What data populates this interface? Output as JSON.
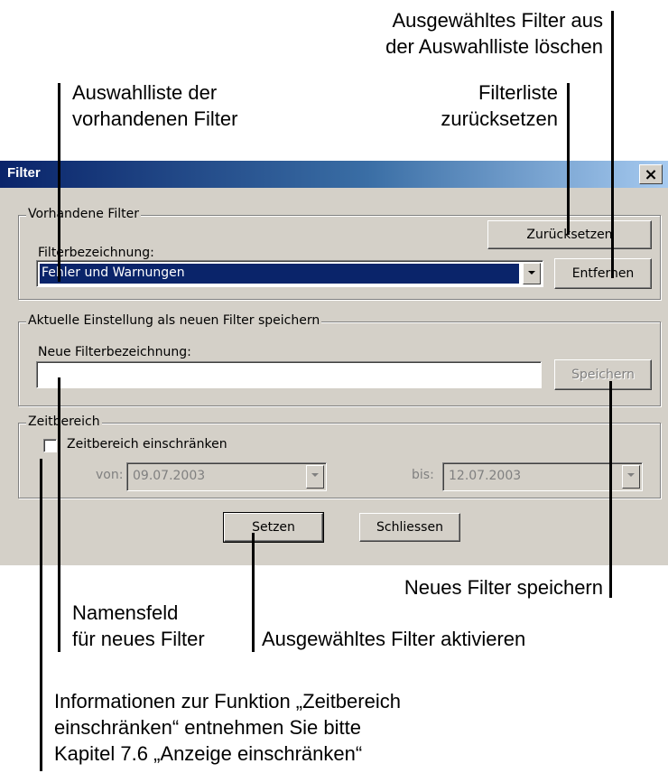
{
  "callouts": {
    "remove_line1": "Ausgewähltes Filter aus",
    "remove_line2": "der Auswahlliste löschen",
    "list_line1": "Auswahlliste der",
    "list_line2": "vorhandenen Filter",
    "reset_line1": "Filterliste",
    "reset_line2": "zurücksetzen",
    "save_new": "Neues Filter speichern",
    "name_line1": "Namensfeld",
    "name_line2": "für neues Filter",
    "activate": "Ausgewähltes Filter aktivieren",
    "info_line1": "Informationen zur Funktion „Zeitbereich",
    "info_line2": "einschränken“ entnehmen Sie bitte",
    "info_line3": "Kapitel 7.6 „Anzeige einschränken“"
  },
  "dialog": {
    "title": "Filter",
    "close_glyph": "×",
    "existing": {
      "legend": "Vorhandene Filter",
      "label": "Filterbezeichnung:",
      "selected": "Fehler und Warnungen",
      "reset_button": "Zurücksetzen",
      "remove_button": "Entfernen"
    },
    "save": {
      "legend": "Aktuelle Einstellung als neuen Filter speichern",
      "label": "Neue Filterbezeichnung:",
      "value": "",
      "save_button": "Speichern"
    },
    "time": {
      "legend": "Zeitbereich",
      "checkbox_label": "Zeitbereich einschränken",
      "checked": false,
      "from_label": "von:",
      "from_value": "09.07.2003",
      "to_label": "bis:",
      "to_value": "12.07.2003"
    },
    "set_button": "Setzen",
    "close_button": "Schliessen"
  }
}
